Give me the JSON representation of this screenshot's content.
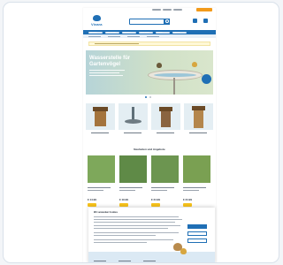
{
  "logo": {
    "text": "Vivara"
  },
  "search": {
    "placeholder": "Suchen..."
  },
  "nav": {
    "items": [
      "Vogelfutter",
      "Futterspender",
      "Nistkästen",
      "Vogeltränken",
      "Insekten",
      "Angebote"
    ]
  },
  "hero": {
    "title_line1": "Wasserstelle für",
    "title_line2": "Gartenvögel"
  },
  "sections": {
    "products_title": "Neuheiten und Angebote"
  },
  "products": [
    {
      "price": "€ 14.99"
    },
    {
      "price": "€ 19.99"
    },
    {
      "price": "€ 24.99"
    },
    {
      "price": "€ 34.99"
    }
  ],
  "cookie": {
    "title": "Wir verwenden Cookies"
  },
  "colors": {
    "brand": "#1f6fb5",
    "accent": "#f7c21b",
    "orange": "#f29a1a"
  }
}
